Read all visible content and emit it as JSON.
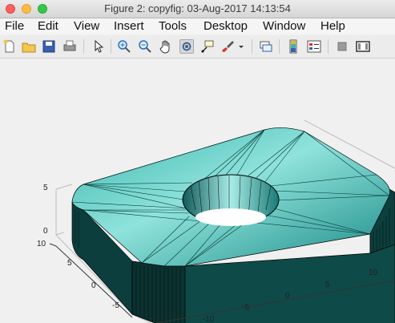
{
  "window": {
    "title": "Figure 2: copyfig: 03-Aug-2017 14:13:54"
  },
  "menu": [
    "File",
    "Edit",
    "View",
    "Insert",
    "Tools",
    "Desktop",
    "Window",
    "Help"
  ],
  "toolbar": {
    "icons": [
      "new-figure-icon",
      "open-file-icon",
      "save-icon",
      "print-icon",
      "pointer-icon",
      "zoom-in-icon",
      "zoom-out-icon",
      "pan-icon",
      "rotate-icon",
      "data-cursor-icon",
      "brush-icon",
      "dropdown-arrow-icon",
      "link-plot-icon",
      "colorbar-icon",
      "legend-icon",
      "hide-plot-tools-icon",
      "show-plot-tools-icon"
    ]
  },
  "plot": {
    "surface_color": "#2aa6a0",
    "z_ticks": [
      "5",
      "0"
    ],
    "y_ticks": [
      "10",
      "5",
      "0",
      "-5"
    ],
    "x_ticks": [
      "-10",
      "-5",
      "0",
      "5",
      "10"
    ]
  }
}
